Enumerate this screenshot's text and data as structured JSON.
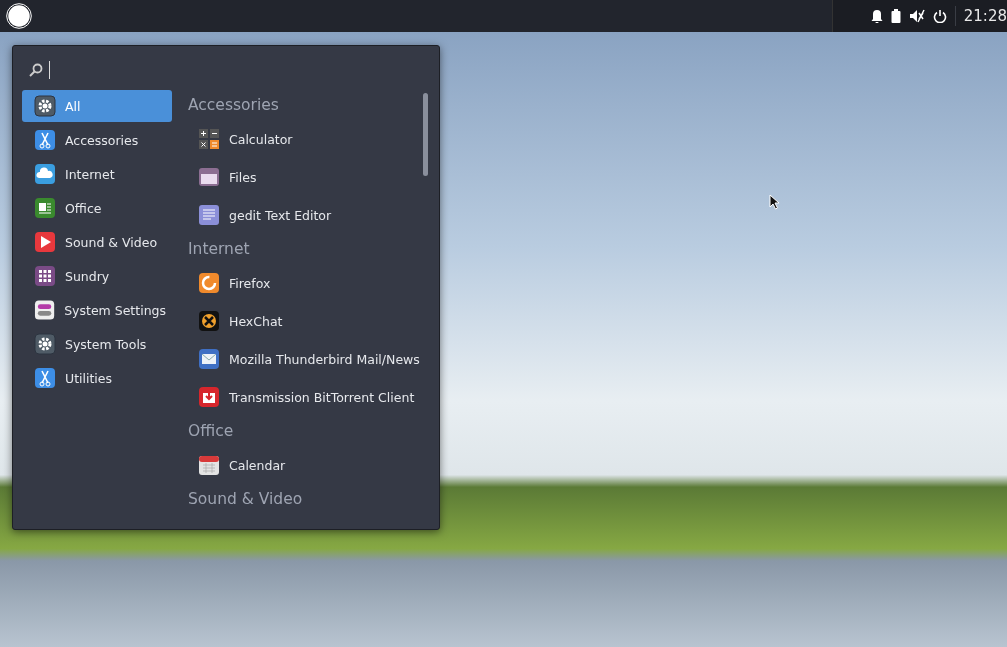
{
  "panel": {
    "clock": "21:28"
  },
  "menu": {
    "categories": [
      {
        "label": "All",
        "selected": true
      },
      {
        "label": "Accessories",
        "selected": false
      },
      {
        "label": "Internet",
        "selected": false
      },
      {
        "label": "Office",
        "selected": false
      },
      {
        "label": "Sound & Video",
        "selected": false
      },
      {
        "label": "Sundry",
        "selected": false
      },
      {
        "label": "System Settings",
        "selected": false
      },
      {
        "label": "System Tools",
        "selected": false
      },
      {
        "label": "Utilities",
        "selected": false
      }
    ],
    "sections": [
      {
        "title": "Accessories",
        "apps": [
          {
            "label": "Calculator"
          },
          {
            "label": "Files"
          },
          {
            "label": "gedit Text Editor"
          }
        ]
      },
      {
        "title": "Internet",
        "apps": [
          {
            "label": "Firefox"
          },
          {
            "label": "HexChat"
          },
          {
            "label": "Mozilla Thunderbird Mail/News"
          },
          {
            "label": "Transmission BitTorrent Client"
          }
        ]
      },
      {
        "title": "Office",
        "apps": [
          {
            "label": "Calendar"
          }
        ]
      },
      {
        "title": "Sound & Video"
      }
    ]
  }
}
